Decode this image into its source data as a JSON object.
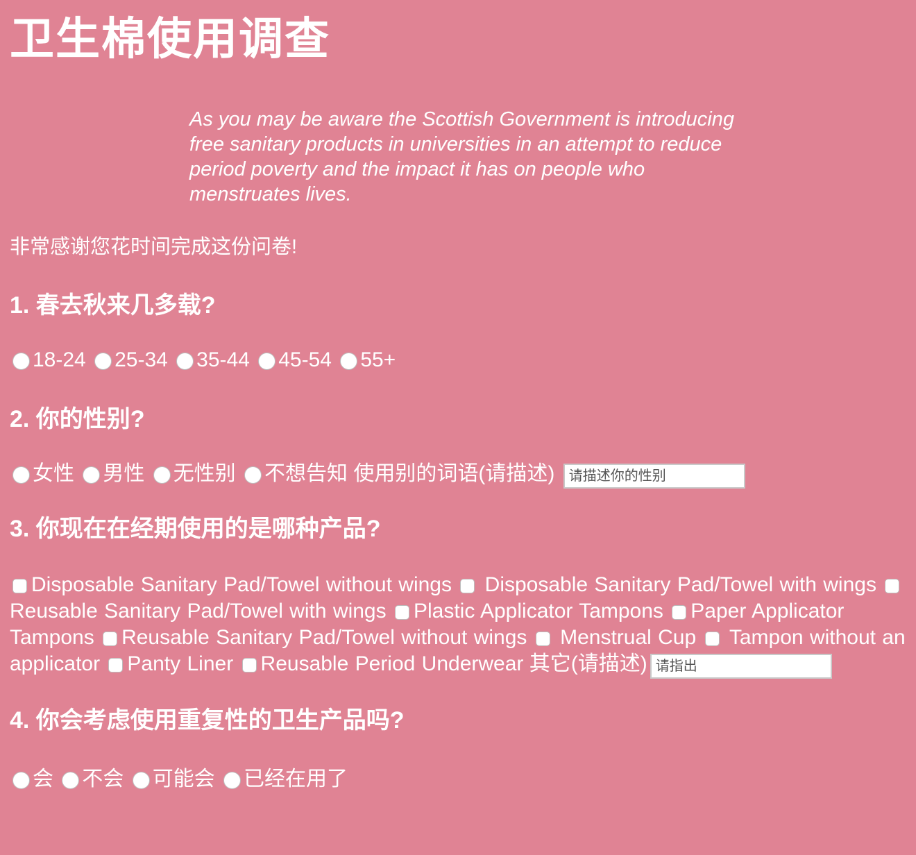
{
  "page": {
    "title": "卫生棉使用调查",
    "intro": "As you may be aware the Scottish Government is introducing free sanitary products in universities in an attempt to reduce period poverty and the impact it has on people who menstruates lives.",
    "thanks": "非常感谢您花时间完成这份问卷!"
  },
  "colors": {
    "background": "#e08394",
    "text": "#ffffff"
  },
  "q1": {
    "title": "1. 春去秋来几多载?",
    "options": [
      "18-24",
      "25-34",
      "35-44",
      "45-54",
      "55+"
    ]
  },
  "q2": {
    "title": "2. 你的性别?",
    "options": [
      "女性",
      "男性",
      "无性别",
      "不想告知"
    ],
    "other_label": "使用别的词语(请描述)",
    "other_placeholder": "请描述你的性别"
  },
  "q3": {
    "title": "3. 你现在在经期使用的是哪种产品?",
    "options": [
      "Disposable Sanitary Pad/Towel without wings",
      "Disposable Sanitary Pad/Towel with wings",
      "Reusable Sanitary Pad/Towel with wings",
      "Plastic Applicator Tampons",
      "Paper Applicator Tampons",
      "Reusable Sanitary Pad/Towel without wings",
      "Menstrual Cup",
      "Tampon without an applicator",
      "Panty Liner",
      "Reusable Period Underwear"
    ],
    "other_label": "其它(请描述)",
    "other_placeholder": "请指出"
  },
  "q4": {
    "title": "4. 你会考虑使用重复性的卫生产品吗?",
    "options": [
      "会",
      "不会",
      "可能会",
      "已经在用了"
    ]
  }
}
